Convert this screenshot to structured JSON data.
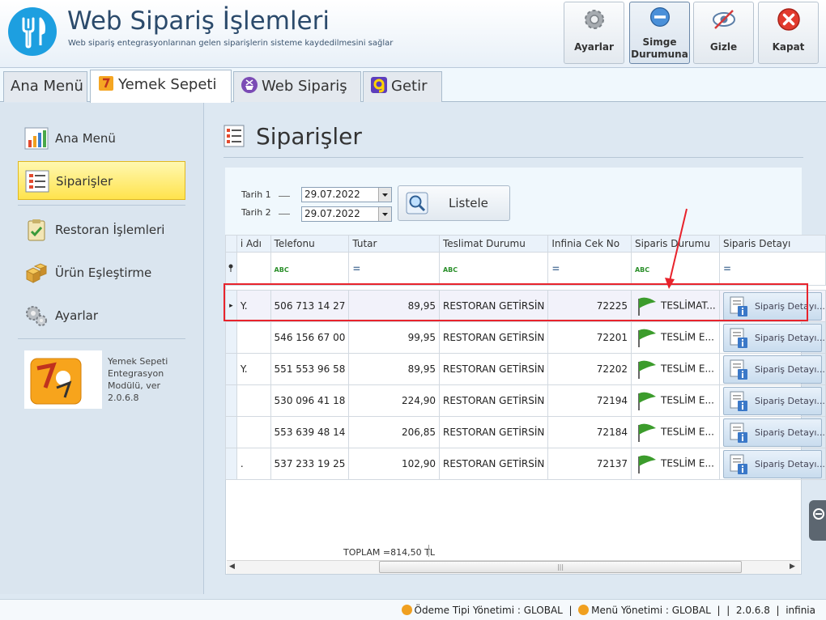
{
  "app": {
    "title": "Web Sipariş İşlemleri",
    "subtitle": "Web sipariş entegrasyonlarınan gelen siparişlerin sisteme kaydedilmesini sağlar"
  },
  "header_buttons": {
    "settings": "Ayarlar",
    "minimize_line1": "Simge",
    "minimize_line2": "Durumuna",
    "hide": "Gizle",
    "close": "Kapat"
  },
  "tabs": [
    "Ana Menü",
    "Yemek Sepeti",
    "Web Sipariş",
    "Getir"
  ],
  "sidebar": {
    "items": [
      "Ana Menü",
      "Siparişler",
      "Restoran İşlemleri",
      "Ürün Eşleştirme",
      "Ayarlar"
    ],
    "module_lines": [
      "Yemek Sepeti",
      "Entegrasyon",
      "Modülü, ver",
      "2.0.6.8"
    ]
  },
  "page": {
    "title": "Siparişler"
  },
  "filter": {
    "date1_label": "Tarih 1",
    "date2_label": "Tarih 2",
    "date1_value": "29.07.2022",
    "date2_value": "29.07.2022",
    "list_button": "Listele"
  },
  "grid": {
    "columns": [
      "i Adı",
      "Telefonu",
      "Tutar",
      "Teslimat Durumu",
      "Infinia Cek No",
      "Siparis Durumu",
      "Siparis Detayı"
    ],
    "filter_row": {
      "abc": "ABC",
      "eq": "="
    },
    "rows": [
      {
        "name": "Y.",
        "phone": "506 713 14 27",
        "amount": "89,95",
        "delivery": "RESTORAN GETİRSİN",
        "check_no": "72225",
        "status": "TESLİMAT...",
        "detail": "Sipariş Detayı..."
      },
      {
        "name": "",
        "phone": "546 156 67 00",
        "amount": "99,95",
        "delivery": "RESTORAN GETİRSİN",
        "check_no": "72201",
        "status": "TESLİM E...",
        "detail": "Sipariş Detayı..."
      },
      {
        "name": "Y.",
        "phone": "551 553 96 58",
        "amount": "89,95",
        "delivery": "RESTORAN GETİRSİN",
        "check_no": "72202",
        "status": "TESLİM E...",
        "detail": "Sipariş Detayı..."
      },
      {
        "name": "",
        "phone": "530 096 41 18",
        "amount": "224,90",
        "delivery": "RESTORAN GETİRSİN",
        "check_no": "72194",
        "status": "TESLİM E...",
        "detail": "Sipariş Detayı..."
      },
      {
        "name": "",
        "phone": "553 639 48 14",
        "amount": "206,85",
        "delivery": "RESTORAN GETİRSİN",
        "check_no": "72184",
        "status": "TESLİM E...",
        "detail": "Sipariş Detayı..."
      },
      {
        "name": ".",
        "phone": "537 233 19 25",
        "amount": "102,90",
        "delivery": "RESTORAN GETİRSİN",
        "check_no": "72137",
        "status": "TESLİM E...",
        "detail": "Sipariş Detayı..."
      }
    ],
    "total": "TOPLAM =814,50 TL"
  },
  "statusbar": {
    "payment": "Ödeme Tipi Yönetimi : GLOBAL",
    "menu": "Menü Yönetimi : GLOBAL",
    "sep": "|",
    "version": "2.0.6.8",
    "company": "infinia"
  },
  "colors": {
    "accent": "#1d9fe0",
    "highlight": "#e8232c",
    "selected_item": "#ffe34d"
  }
}
